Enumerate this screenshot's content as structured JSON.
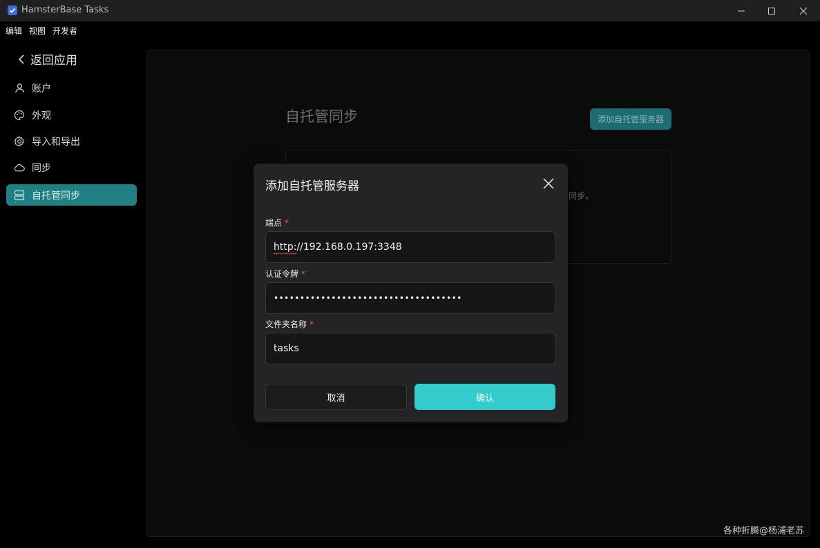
{
  "window": {
    "title": "HamsterBase Tasks",
    "icon": "checkbox-icon",
    "controls": [
      "minimize-icon",
      "maximize-icon",
      "close-icon"
    ]
  },
  "menu": [
    "编辑",
    "视图",
    "开发者"
  ],
  "sidebar": {
    "back_label": "返回应用",
    "items": [
      {
        "label": "账户",
        "icon": "user-icon",
        "active": false
      },
      {
        "label": "外观",
        "icon": "palette-icon",
        "active": false
      },
      {
        "label": "导入和导出",
        "icon": "gear-icon",
        "active": false
      },
      {
        "label": "同步",
        "icon": "cloud-icon",
        "active": false
      },
      {
        "label": "自托管同步",
        "icon": "server-icon",
        "active": true
      }
    ]
  },
  "main": {
    "title": "自托管同步",
    "add_button": "添加自托管服务器",
    "card_text": "同步。"
  },
  "modal": {
    "title": "添加自托管服务器",
    "fields": [
      {
        "label": "端点",
        "required": true,
        "value": "http://192.168.0.197:3348",
        "type": "text"
      },
      {
        "label": "认证令牌",
        "required": true,
        "value": "••••••••••••••••••••••••••••••••••••",
        "type": "password"
      },
      {
        "label": "文件夹名称",
        "required": true,
        "value": "tasks",
        "type": "text"
      }
    ],
    "cancel": "取消",
    "confirm": "确认"
  },
  "watermark": "各种折腾@杨浦老苏",
  "colors": {
    "accent": "#32cccc",
    "active_nav": "#1f7f82",
    "modal_bg": "#242427",
    "required_star": "#e05a5a"
  }
}
